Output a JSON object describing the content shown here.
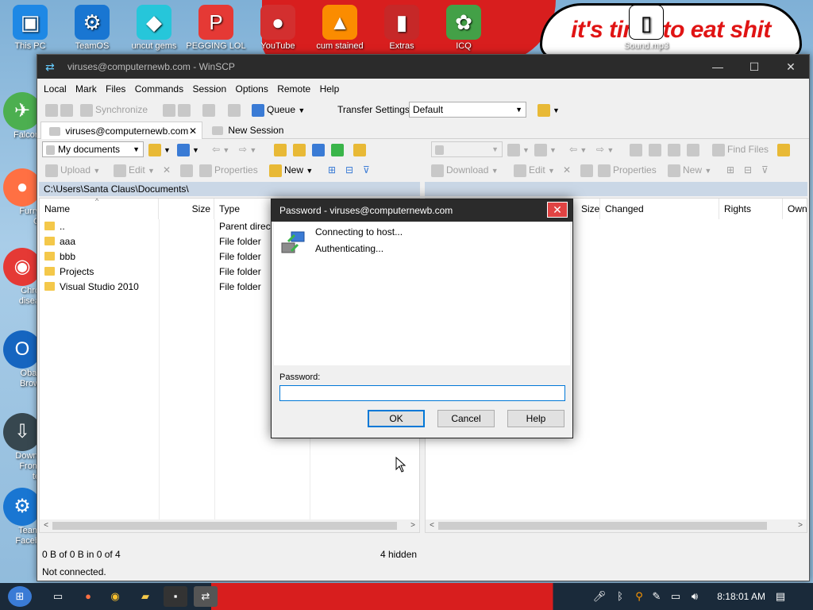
{
  "desktop": {
    "banner": "it's time to eat shit",
    "top_icons": [
      {
        "label": "This PC",
        "icon": "monitor-icon",
        "color": "#1e88e5"
      },
      {
        "label": "TeamOS",
        "icon": "gear-icon",
        "color": "#1976d2"
      },
      {
        "label": "uncut gems",
        "icon": "gem-icon",
        "color": "#26c6da"
      },
      {
        "label": "PEGGING LOL",
        "icon": "p-logo-icon",
        "color": "#e53935"
      },
      {
        "label": "YouTube",
        "icon": "angry-bird-icon",
        "color": "#d32f2f"
      },
      {
        "label": "cum stained",
        "icon": "cake-icon",
        "color": "#fb8c00"
      },
      {
        "label": "Extras",
        "icon": "book-icon",
        "color": "#c62828"
      },
      {
        "label": "ICQ",
        "icon": "flower-icon",
        "color": "#43a047"
      },
      {
        "label": "Sound.mp3",
        "icon": "file-icon",
        "color": "#ffffff"
      }
    ],
    "side_icons": [
      {
        "label": "Falcon",
        "icon": "falcon-icon",
        "color": "#4caf50"
      },
      {
        "label": "Furry C",
        "icon": "firefox-icon",
        "color": "#ff7043"
      },
      {
        "label": "Chro disea",
        "icon": "chrome-icon",
        "color": "#e53935"
      },
      {
        "label": "Obar Brow",
        "icon": "obama-icon",
        "color": "#1565c0"
      },
      {
        "label": "Downl From te",
        "icon": "download-icon",
        "color": "#37474f"
      },
      {
        "label": "Team Faceb",
        "icon": "gear-icon",
        "color": "#1976d2"
      }
    ]
  },
  "window": {
    "title": "viruses@computernewb.com - WinSCP",
    "menu": [
      "Local",
      "Mark",
      "Files",
      "Commands",
      "Session",
      "Options",
      "Remote",
      "Help"
    ],
    "toolbar1": {
      "synchronize": "Synchronize",
      "queue": "Queue",
      "transfer_settings": "Transfer Settings",
      "transfer_value": "Default"
    },
    "tabs": [
      {
        "label": "viruses@computernewb.com"
      },
      {
        "label": "New Session"
      }
    ],
    "local_nav": {
      "location": "My documents"
    },
    "remote_nav": {
      "find_files": "Find Files"
    },
    "local_actions": {
      "upload": "Upload",
      "edit": "Edit",
      "properties": "Properties",
      "new": "New"
    },
    "remote_actions": {
      "download": "Download",
      "edit": "Edit",
      "properties": "Properties",
      "new": "New"
    },
    "local_path": "C:\\Users\\Santa Claus\\Documents\\",
    "local_columns": [
      "Name",
      "Size",
      "Type"
    ],
    "local_files": [
      {
        "name": "..",
        "type": "Parent direct"
      },
      {
        "name": "aaa",
        "type": "File folder"
      },
      {
        "name": "bbb",
        "type": "File folder"
      },
      {
        "name": "Projects",
        "type": "File folder"
      },
      {
        "name": "Visual Studio 2010",
        "type": "File folder"
      }
    ],
    "remote_columns": [
      "Size",
      "Changed",
      "Rights",
      "Own"
    ],
    "status_left": "0 B of 0 B in 0 of 4",
    "status_hidden": "4 hidden",
    "status_bottom": "Not connected."
  },
  "dialog": {
    "title": "Password - viruses@computernewb.com",
    "messages": [
      "Connecting to host...",
      "Authenticating..."
    ],
    "password_label": "Password:",
    "password_value": "",
    "ok": "OK",
    "cancel": "Cancel",
    "help": "Help"
  },
  "taskbar": {
    "clock": "8:18:01 AM"
  }
}
